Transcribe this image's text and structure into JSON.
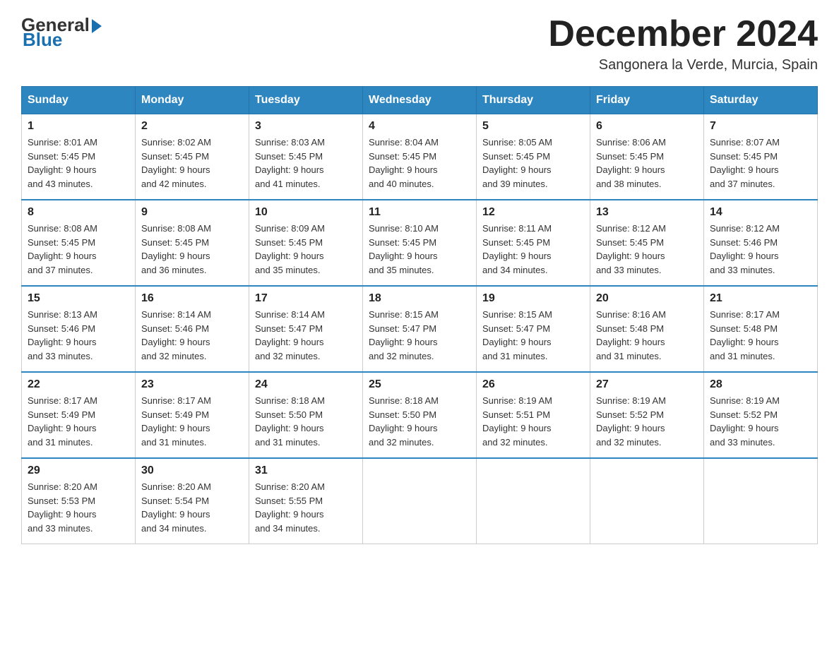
{
  "header": {
    "logo_general": "General",
    "logo_blue": "Blue",
    "month_title": "December 2024",
    "subtitle": "Sangonera la Verde, Murcia, Spain"
  },
  "days_of_week": [
    "Sunday",
    "Monday",
    "Tuesday",
    "Wednesday",
    "Thursday",
    "Friday",
    "Saturday"
  ],
  "weeks": [
    [
      {
        "day": "1",
        "sunrise": "8:01 AM",
        "sunset": "5:45 PM",
        "daylight": "9 hours and 43 minutes."
      },
      {
        "day": "2",
        "sunrise": "8:02 AM",
        "sunset": "5:45 PM",
        "daylight": "9 hours and 42 minutes."
      },
      {
        "day": "3",
        "sunrise": "8:03 AM",
        "sunset": "5:45 PM",
        "daylight": "9 hours and 41 minutes."
      },
      {
        "day": "4",
        "sunrise": "8:04 AM",
        "sunset": "5:45 PM",
        "daylight": "9 hours and 40 minutes."
      },
      {
        "day": "5",
        "sunrise": "8:05 AM",
        "sunset": "5:45 PM",
        "daylight": "9 hours and 39 minutes."
      },
      {
        "day": "6",
        "sunrise": "8:06 AM",
        "sunset": "5:45 PM",
        "daylight": "9 hours and 38 minutes."
      },
      {
        "day": "7",
        "sunrise": "8:07 AM",
        "sunset": "5:45 PM",
        "daylight": "9 hours and 37 minutes."
      }
    ],
    [
      {
        "day": "8",
        "sunrise": "8:08 AM",
        "sunset": "5:45 PM",
        "daylight": "9 hours and 37 minutes."
      },
      {
        "day": "9",
        "sunrise": "8:08 AM",
        "sunset": "5:45 PM",
        "daylight": "9 hours and 36 minutes."
      },
      {
        "day": "10",
        "sunrise": "8:09 AM",
        "sunset": "5:45 PM",
        "daylight": "9 hours and 35 minutes."
      },
      {
        "day": "11",
        "sunrise": "8:10 AM",
        "sunset": "5:45 PM",
        "daylight": "9 hours and 35 minutes."
      },
      {
        "day": "12",
        "sunrise": "8:11 AM",
        "sunset": "5:45 PM",
        "daylight": "9 hours and 34 minutes."
      },
      {
        "day": "13",
        "sunrise": "8:12 AM",
        "sunset": "5:45 PM",
        "daylight": "9 hours and 33 minutes."
      },
      {
        "day": "14",
        "sunrise": "8:12 AM",
        "sunset": "5:46 PM",
        "daylight": "9 hours and 33 minutes."
      }
    ],
    [
      {
        "day": "15",
        "sunrise": "8:13 AM",
        "sunset": "5:46 PM",
        "daylight": "9 hours and 33 minutes."
      },
      {
        "day": "16",
        "sunrise": "8:14 AM",
        "sunset": "5:46 PM",
        "daylight": "9 hours and 32 minutes."
      },
      {
        "day": "17",
        "sunrise": "8:14 AM",
        "sunset": "5:47 PM",
        "daylight": "9 hours and 32 minutes."
      },
      {
        "day": "18",
        "sunrise": "8:15 AM",
        "sunset": "5:47 PM",
        "daylight": "9 hours and 32 minutes."
      },
      {
        "day": "19",
        "sunrise": "8:15 AM",
        "sunset": "5:47 PM",
        "daylight": "9 hours and 31 minutes."
      },
      {
        "day": "20",
        "sunrise": "8:16 AM",
        "sunset": "5:48 PM",
        "daylight": "9 hours and 31 minutes."
      },
      {
        "day": "21",
        "sunrise": "8:17 AM",
        "sunset": "5:48 PM",
        "daylight": "9 hours and 31 minutes."
      }
    ],
    [
      {
        "day": "22",
        "sunrise": "8:17 AM",
        "sunset": "5:49 PM",
        "daylight": "9 hours and 31 minutes."
      },
      {
        "day": "23",
        "sunrise": "8:17 AM",
        "sunset": "5:49 PM",
        "daylight": "9 hours and 31 minutes."
      },
      {
        "day": "24",
        "sunrise": "8:18 AM",
        "sunset": "5:50 PM",
        "daylight": "9 hours and 31 minutes."
      },
      {
        "day": "25",
        "sunrise": "8:18 AM",
        "sunset": "5:50 PM",
        "daylight": "9 hours and 32 minutes."
      },
      {
        "day": "26",
        "sunrise": "8:19 AM",
        "sunset": "5:51 PM",
        "daylight": "9 hours and 32 minutes."
      },
      {
        "day": "27",
        "sunrise": "8:19 AM",
        "sunset": "5:52 PM",
        "daylight": "9 hours and 32 minutes."
      },
      {
        "day": "28",
        "sunrise": "8:19 AM",
        "sunset": "5:52 PM",
        "daylight": "9 hours and 33 minutes."
      }
    ],
    [
      {
        "day": "29",
        "sunrise": "8:20 AM",
        "sunset": "5:53 PM",
        "daylight": "9 hours and 33 minutes."
      },
      {
        "day": "30",
        "sunrise": "8:20 AM",
        "sunset": "5:54 PM",
        "daylight": "9 hours and 34 minutes."
      },
      {
        "day": "31",
        "sunrise": "8:20 AM",
        "sunset": "5:55 PM",
        "daylight": "9 hours and 34 minutes."
      },
      null,
      null,
      null,
      null
    ]
  ],
  "labels": {
    "sunrise": "Sunrise:",
    "sunset": "Sunset:",
    "daylight": "Daylight:"
  }
}
